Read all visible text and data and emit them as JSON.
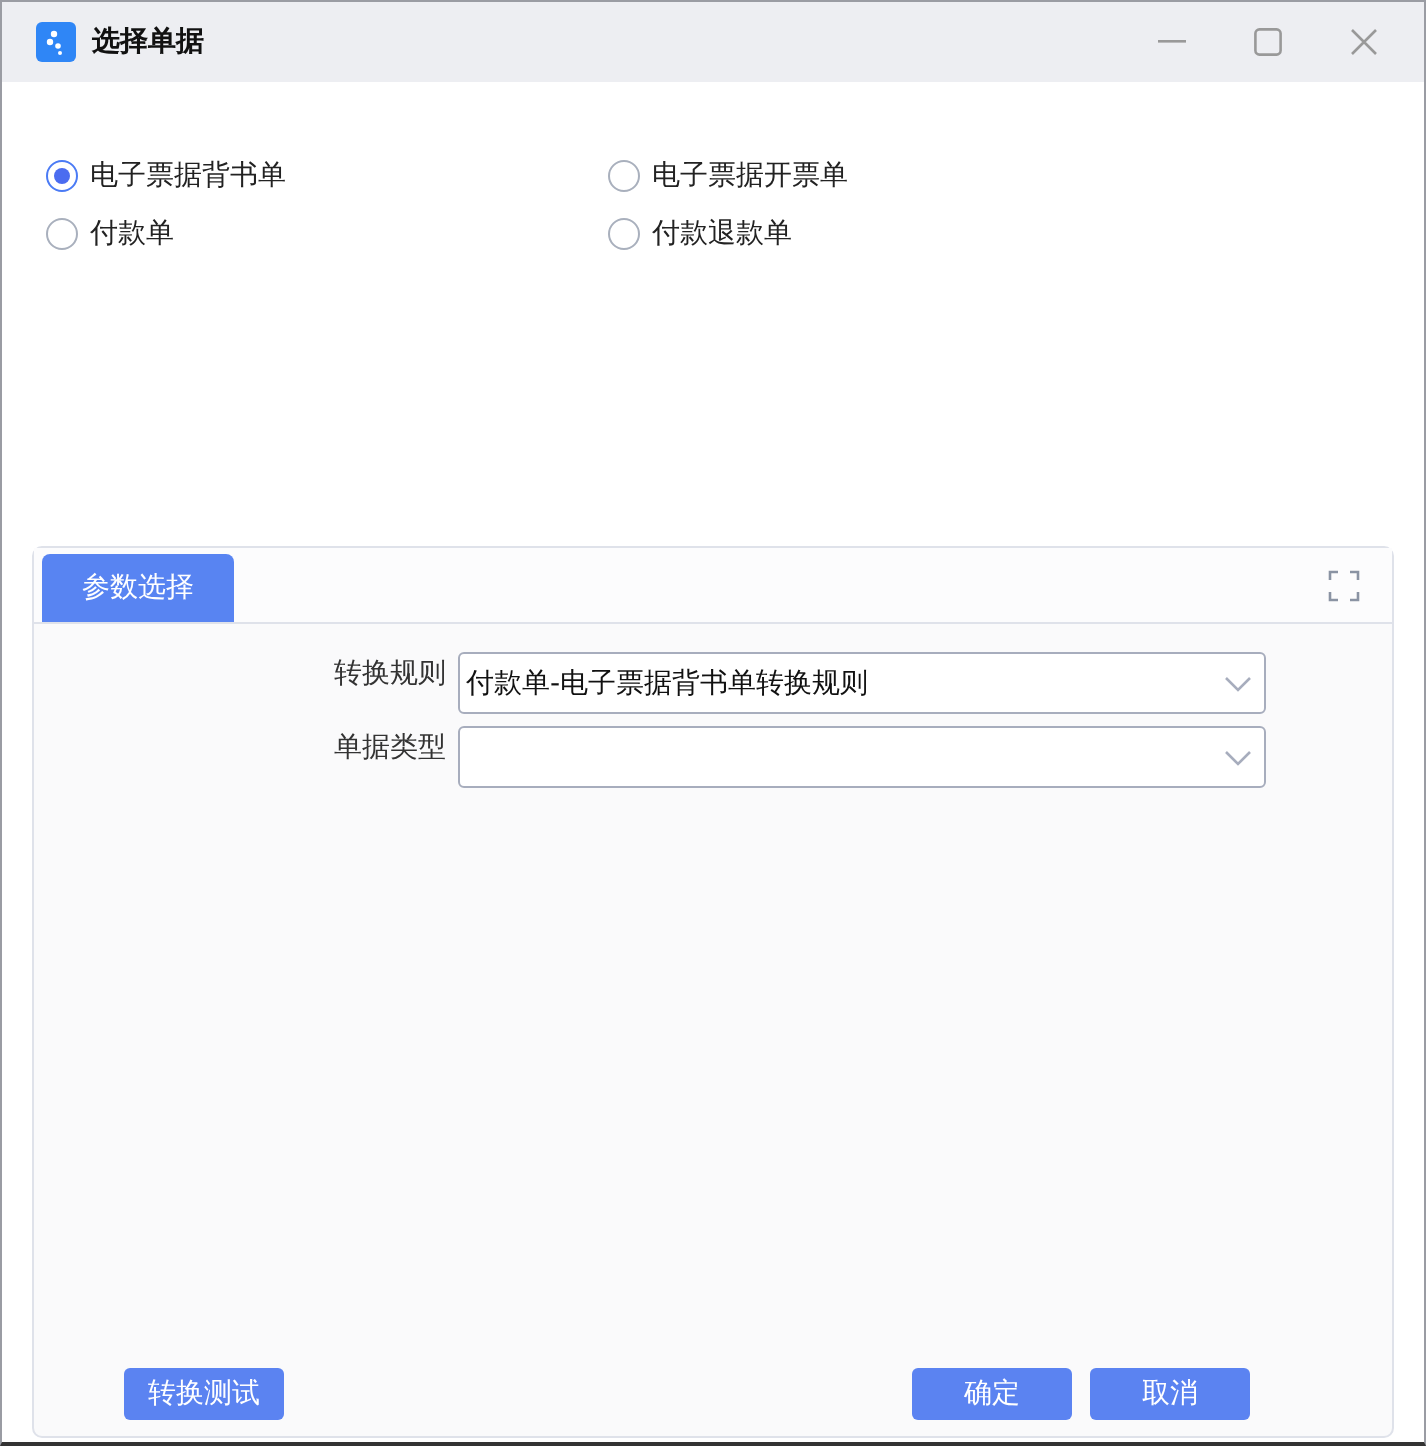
{
  "window": {
    "title": "选择单据"
  },
  "options": [
    {
      "label": "电子票据背书单",
      "selected": true
    },
    {
      "label": "电子票据开票单",
      "selected": false
    },
    {
      "label": "付款单",
      "selected": false
    },
    {
      "label": "付款退款单",
      "selected": false
    }
  ],
  "panel": {
    "tabs": [
      {
        "label": "参数选择",
        "selected": true
      }
    ],
    "fields": [
      {
        "label": "转换规则",
        "value": "付款单-电子票据背书单转换规则"
      },
      {
        "label": "单据类型"
      }
    ]
  },
  "buttons": {
    "left": "转换测试",
    "right": [
      "确定",
      "取消"
    ]
  }
}
